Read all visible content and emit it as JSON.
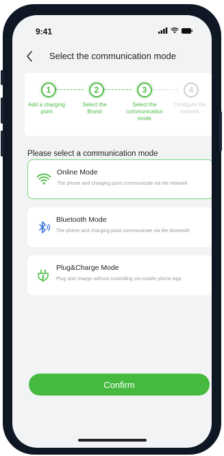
{
  "status_bar": {
    "time": "9:41"
  },
  "nav": {
    "title": "Select the communication mode"
  },
  "steps": [
    {
      "number": "1",
      "label": "Add a charging point",
      "active": true
    },
    {
      "number": "2",
      "label": "Select the Brand",
      "active": true
    },
    {
      "number": "3",
      "label": "Select the communication mode",
      "active": true
    },
    {
      "number": "4",
      "label": "Configure the network",
      "active": false
    }
  ],
  "section": {
    "title": "Please select a communication mode"
  },
  "modes": [
    {
      "title": "Online Mode",
      "description": "The phone and charging point communicate via the network",
      "icon": "wifi-icon",
      "selected": true
    },
    {
      "title": "Bluetooth Mode",
      "description": "The phone and charging point communicate via the bluetooth",
      "icon": "bluetooth-icon",
      "selected": false
    },
    {
      "title": "Plug&Charge Mode",
      "description": "Plug and charge without controlling via mobile phone App",
      "icon": "plug-charge-icon",
      "selected": false
    }
  ],
  "confirm": {
    "label": "Confirm"
  },
  "colors": {
    "accent": "#46ba3f",
    "inactive": "#cfcfcf",
    "bluetooth": "#2f6fdc",
    "background": "#f2f3f5"
  }
}
